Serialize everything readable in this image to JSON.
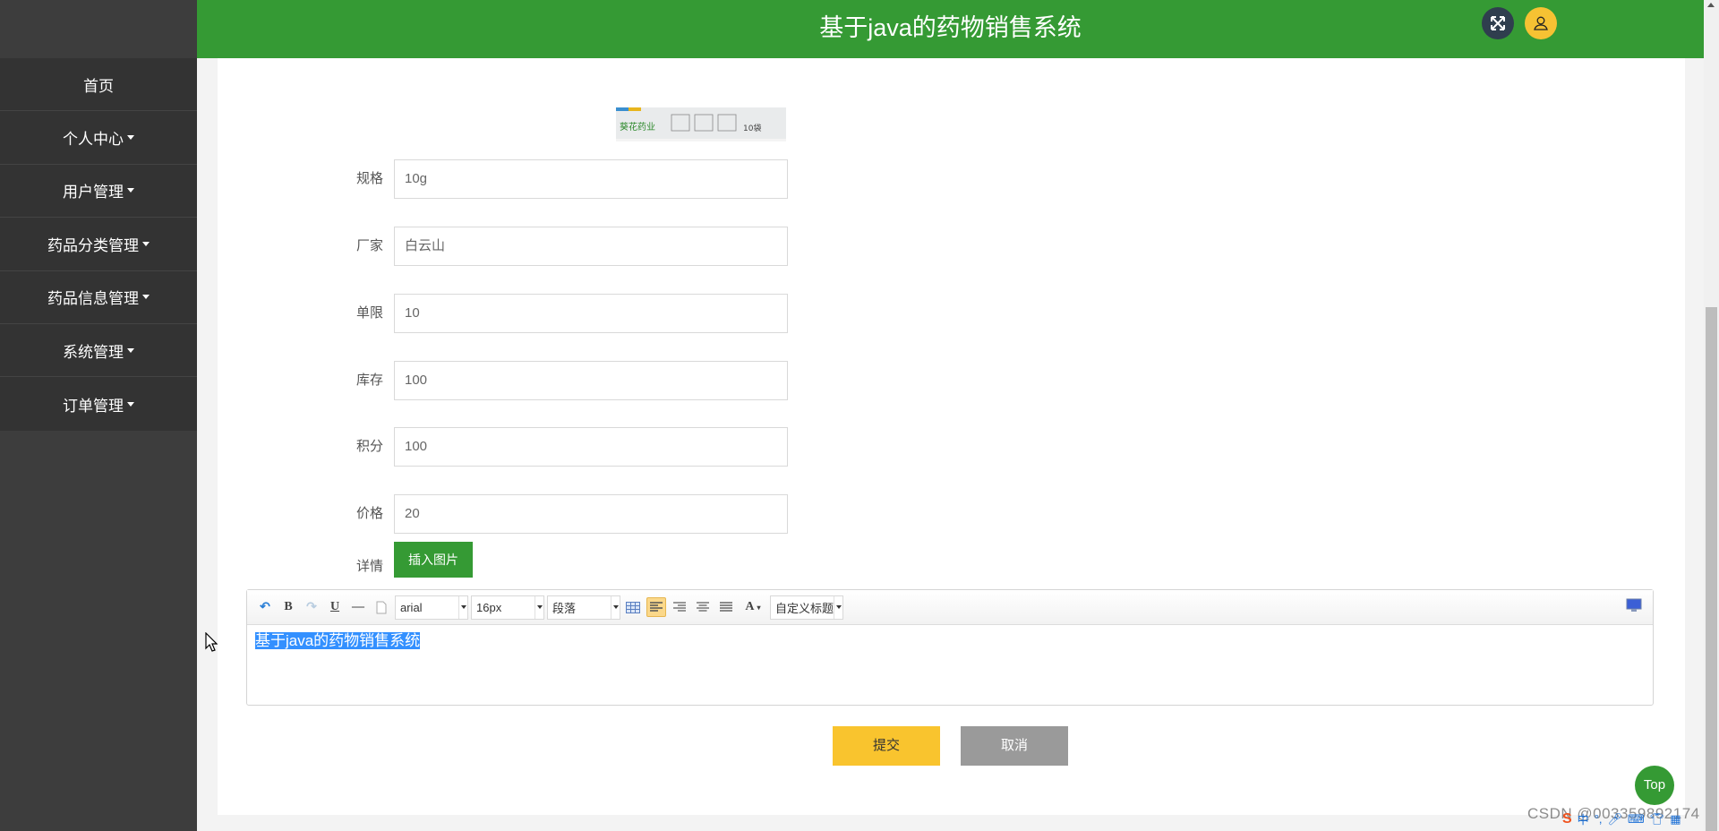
{
  "header": {
    "title": "基于java的药物销售系统",
    "fullscreen_icon": "expand-arrows-icon",
    "user_icon": "user-icon"
  },
  "sidebar": {
    "items": [
      {
        "label": "首页",
        "has_caret": false
      },
      {
        "label": "个人中心",
        "has_caret": true
      },
      {
        "label": "用户管理",
        "has_caret": true
      },
      {
        "label": "药品分类管理",
        "has_caret": true
      },
      {
        "label": "药品信息管理",
        "has_caret": true
      },
      {
        "label": "系统管理",
        "has_caret": true
      },
      {
        "label": "订单管理",
        "has_caret": true
      }
    ]
  },
  "form": {
    "fields": [
      {
        "label": "规格",
        "value": "10g"
      },
      {
        "label": "厂家",
        "value": "白云山"
      },
      {
        "label": "单限",
        "value": "10"
      },
      {
        "label": "库存",
        "value": "100"
      },
      {
        "label": "积分",
        "value": "100"
      },
      {
        "label": "价格",
        "value": "20"
      }
    ],
    "detail_label": "详情",
    "insert_image_label": "插入图片"
  },
  "editor": {
    "font_family": "arial",
    "font_size": "16px",
    "paragraph": "段落",
    "custom_heading": "自定义标题",
    "content": "基于java的药物销售系统",
    "toolbar_icons": [
      "undo-icon",
      "bold-icon",
      "redo-icon",
      "underline-icon",
      "horizontal-rule-icon",
      "page-icon",
      "table-icon",
      "align-left-icon",
      "align-right-icon",
      "align-center-icon",
      "justify-icon",
      "font-color-icon",
      "preview-icon"
    ]
  },
  "actions": {
    "submit_label": "提交",
    "cancel_label": "取消",
    "top_label": "Top"
  },
  "watermark": "CSDN @0033598921​74",
  "colors": {
    "brand_green": "#359a34",
    "submit_yellow": "#f9c42e",
    "cancel_gray": "#9a9a9a",
    "sidebar_dark": "#333333"
  }
}
